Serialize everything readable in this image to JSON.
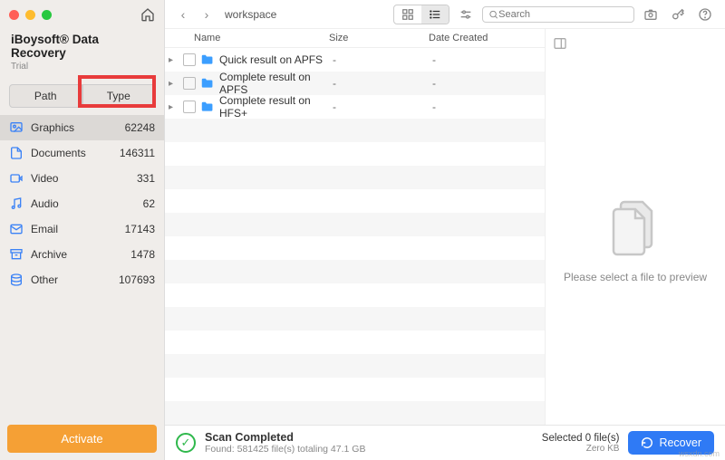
{
  "app": {
    "title": "iBoysoft® Data Recovery",
    "subtitle": "Trial"
  },
  "sidebar": {
    "tabs": {
      "path": "Path",
      "type": "Type"
    },
    "categories": [
      {
        "icon": "image",
        "name": "Graphics",
        "count": "62248",
        "selected": true
      },
      {
        "icon": "document",
        "name": "Documents",
        "count": "146311"
      },
      {
        "icon": "video",
        "name": "Video",
        "count": "331"
      },
      {
        "icon": "audio",
        "name": "Audio",
        "count": "62"
      },
      {
        "icon": "email",
        "name": "Email",
        "count": "17143"
      },
      {
        "icon": "archive",
        "name": "Archive",
        "count": "1478"
      },
      {
        "icon": "other",
        "name": "Other",
        "count": "107693"
      }
    ],
    "activate": "Activate"
  },
  "toolbar": {
    "breadcrumb": "workspace",
    "search_placeholder": "Search"
  },
  "columns": {
    "name": "Name",
    "size": "Size",
    "date": "Date Created"
  },
  "rows": [
    {
      "name": "Quick result on APFS",
      "size": "-",
      "date": "-"
    },
    {
      "name": "Complete result on APFS",
      "size": "-",
      "date": "-"
    },
    {
      "name": "Complete result on HFS+",
      "size": "-",
      "date": "-"
    }
  ],
  "preview": {
    "message": "Please select a file to preview"
  },
  "status": {
    "title": "Scan Completed",
    "detail": "Found: 581425 file(s) totaling 47.1 GB",
    "selected": "Selected 0 file(s)",
    "selected_size": "Zero KB",
    "recover": "Recover"
  },
  "watermark": "wsxdn.com"
}
